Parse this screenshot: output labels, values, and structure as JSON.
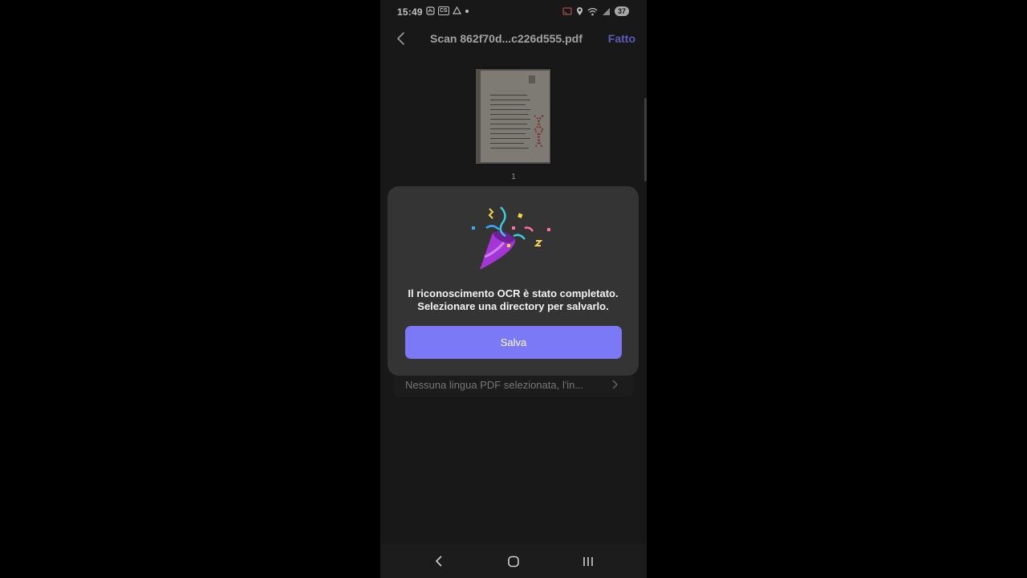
{
  "statusbar": {
    "time": "15:49",
    "left_icons": [
      "notification-icon",
      "cs-icon",
      "drive-icon",
      "dot-icon"
    ],
    "cs_label": "CS",
    "battery": "37",
    "right_icons": [
      "cast-icon",
      "location-icon",
      "wifi-icon",
      "signal-icon"
    ]
  },
  "appbar": {
    "title": "Scan 862f70d...c226d555.pdf",
    "done_label": "Fatto"
  },
  "document": {
    "page_number": "1"
  },
  "language_row": {
    "text": "Nessuna lingua PDF selezionata, l'in..."
  },
  "dialog": {
    "message_line1": "Il riconoscimento OCR è stato completato.",
    "message_line2": "Selezionare una directory per salvarlo.",
    "save_label": "Salva",
    "illustration": "party-popper-icon"
  },
  "colors": {
    "accent": "#7b79f5",
    "background": "#202020",
    "dialog": "#343434"
  }
}
